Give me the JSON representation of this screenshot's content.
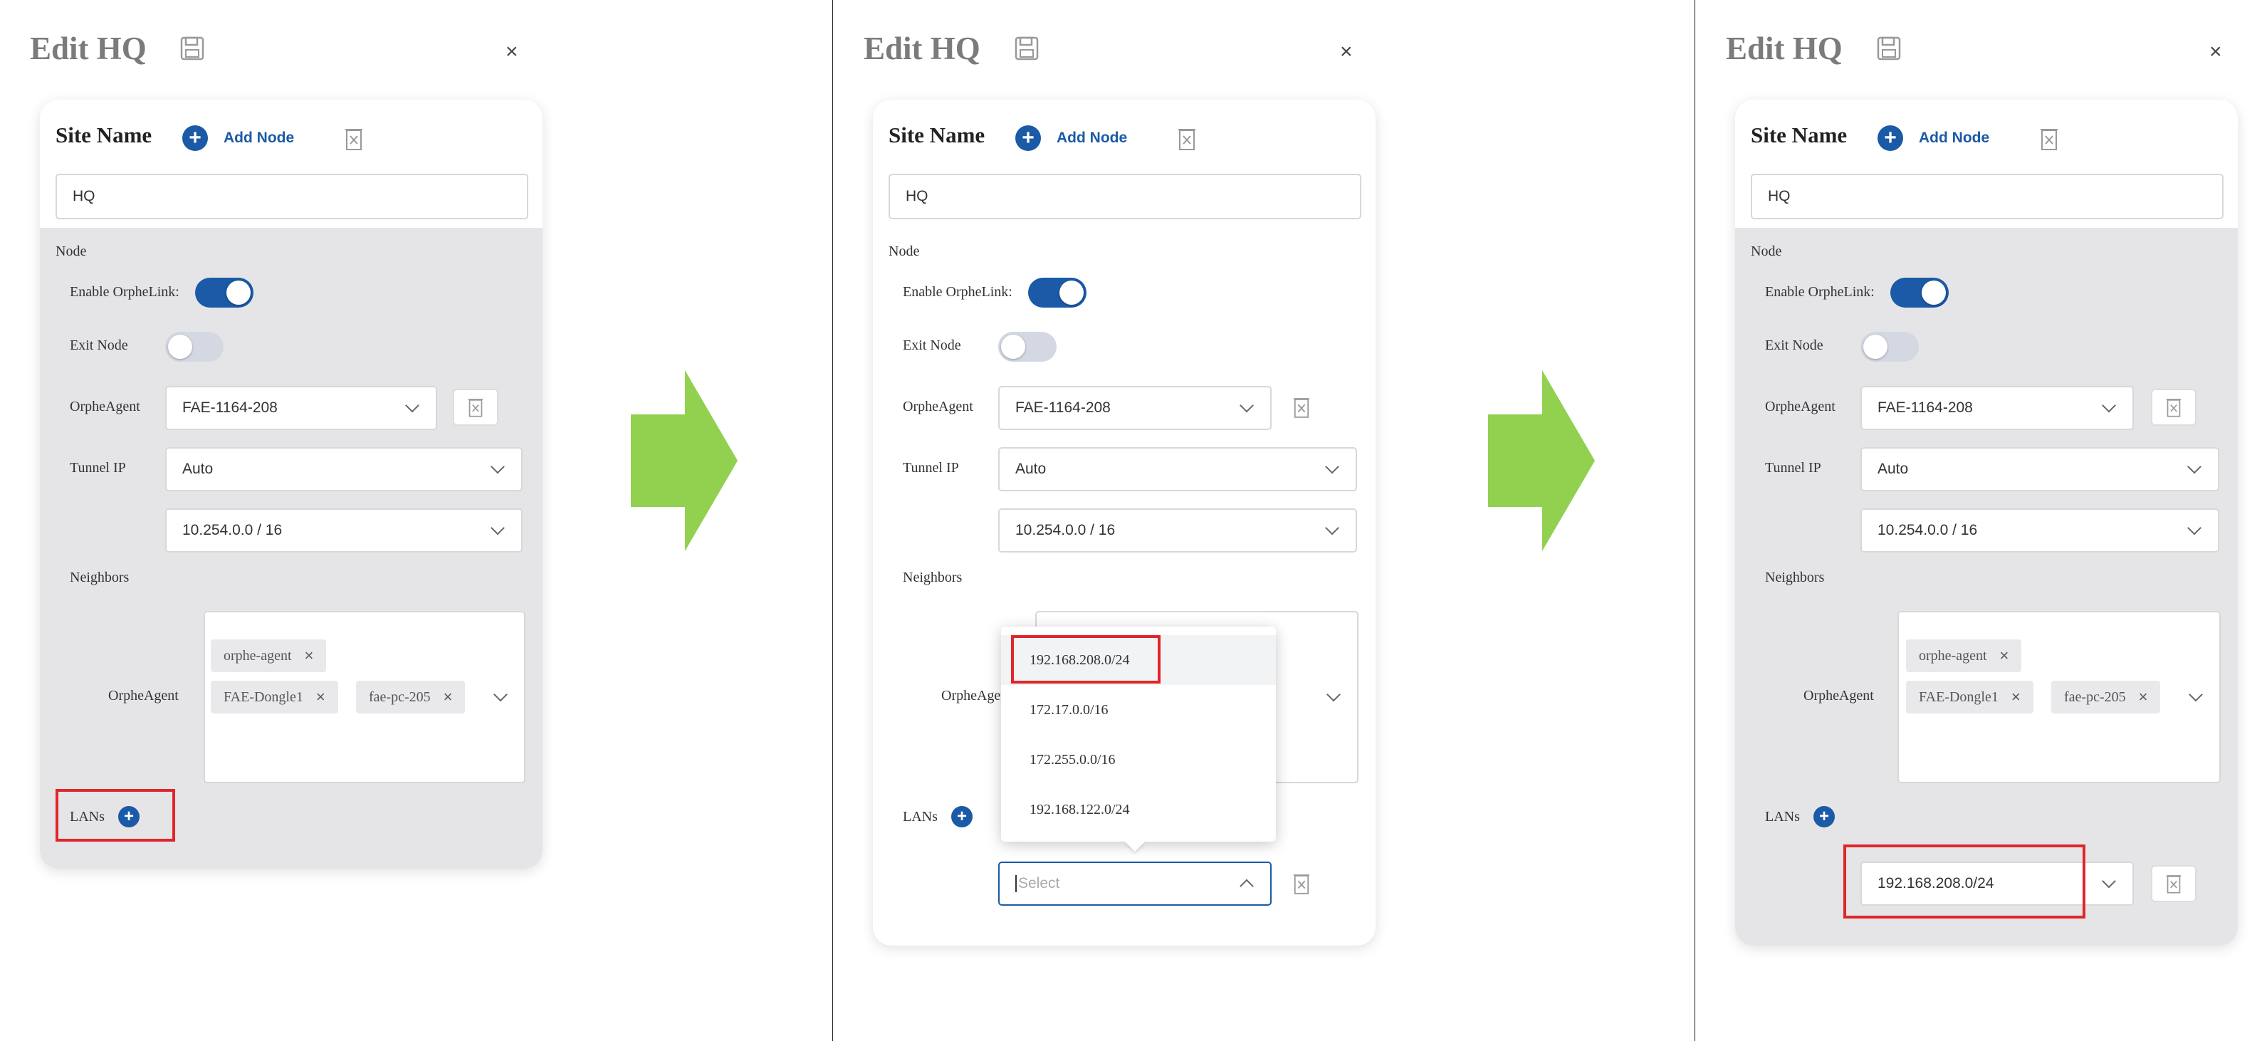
{
  "dialog": {
    "title": "Edit HQ",
    "close_glyph": "×"
  },
  "site": {
    "label": "Site Name",
    "add_node_label": "Add Node",
    "value": "HQ"
  },
  "node": {
    "section_label": "Node",
    "enable_label": "Enable OrpheLink:",
    "exit_label": "Exit Node",
    "agent_label": "OrpheAgent",
    "agent_value": "FAE-1164-208",
    "tunnel_label": "Tunnel IP",
    "tunnel_value": "Auto",
    "subnet_value": "10.254.0.0 / 16",
    "neighbors_label": "Neighbors",
    "neighbors_agent_label": "OrpheAgent",
    "tags": [
      "orphe-agent",
      "FAE-Dongle1",
      "fae-pc-205"
    ],
    "tag_close": "×",
    "lans_label": "LANs"
  },
  "lan_dropdown": {
    "options": [
      "192.168.208.0/24",
      "172.17.0.0/16",
      "172.255.0.0/16",
      "192.168.122.0/24"
    ],
    "placeholder": "Select"
  },
  "lan_selected": "192.168.208.0/24",
  "colors": {
    "accent": "#1a5aa6",
    "highlight": "#e0262a",
    "arrow": "#92d050",
    "node_bg": "#e5e5e7"
  }
}
